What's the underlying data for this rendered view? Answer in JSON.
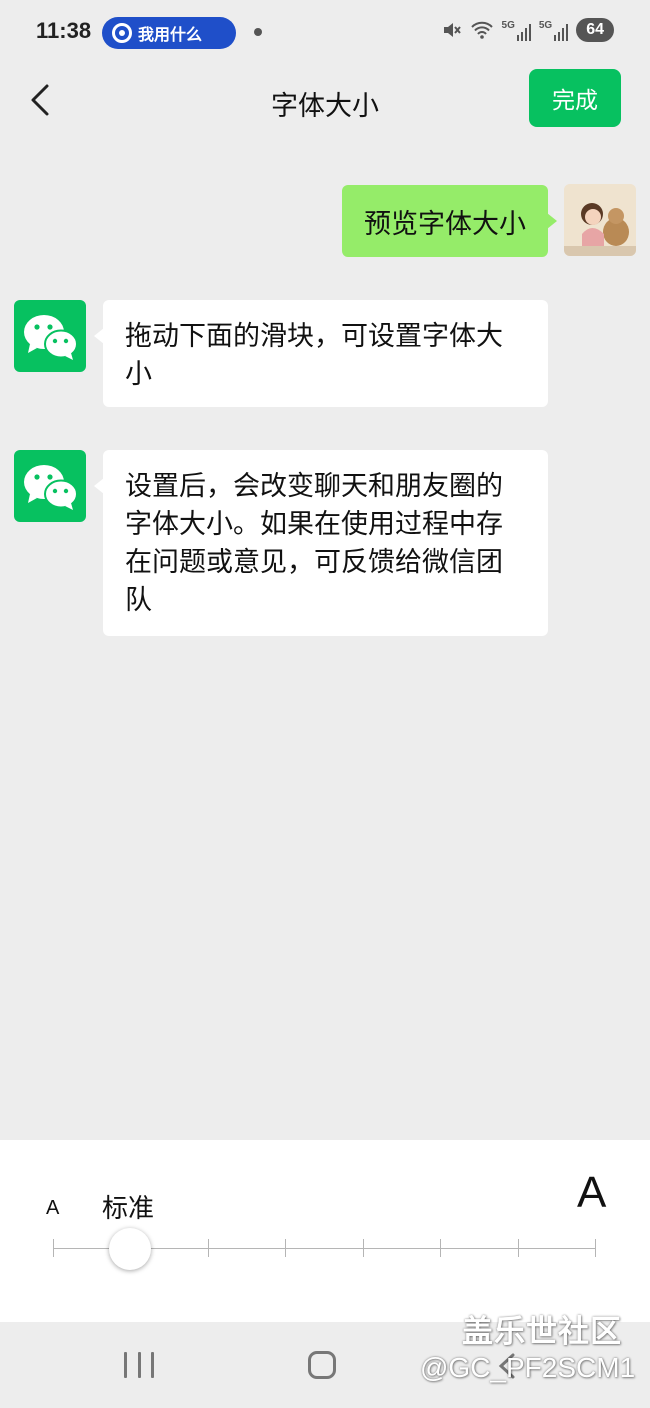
{
  "status_bar": {
    "time": "11:38",
    "notification_pill": "我用什么",
    "network_1": "5G",
    "network_2": "5G",
    "battery": "64"
  },
  "nav": {
    "title": "字体大小",
    "done_label": "完成"
  },
  "chat": {
    "user_message": "预览字体大小",
    "bot_messages": [
      "拖动下面的滑块，可设置字体大小",
      "设置后，会改变聊天和朋友圈的字体大小。如果在使用过程中存在问题或意见，可反馈给微信团队"
    ]
  },
  "font_size_panel": {
    "small_a": "A",
    "level_label": "标准",
    "large_a": "A",
    "slider_level": 1,
    "slider_level_count": 8
  },
  "watermark": {
    "site": "盖乐世社区",
    "user": "@GC_PF2SCM1"
  },
  "colors": {
    "accent": "#07c160",
    "user_bubble": "#95ec69",
    "background": "#ededed"
  }
}
